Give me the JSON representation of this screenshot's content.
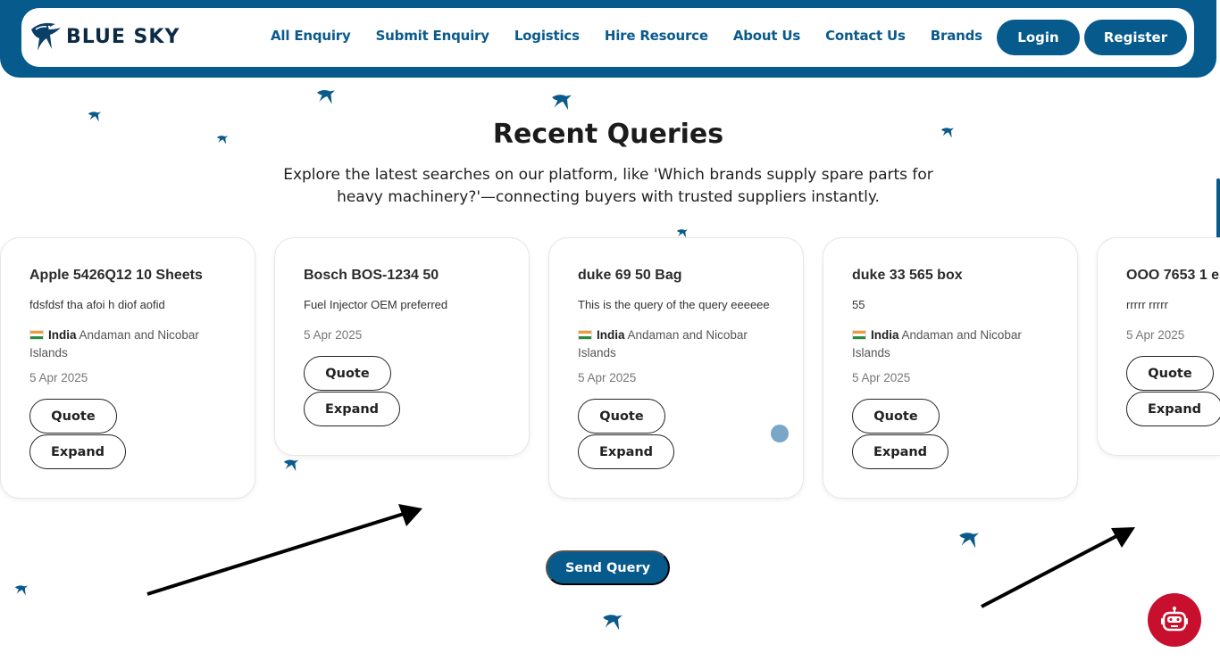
{
  "header": {
    "logo_text": "BLUE SKY",
    "nav": [
      "All Enquiry",
      "Submit Enquiry",
      "Logistics",
      "Hire Resource",
      "About Us",
      "Contact Us",
      "Brands"
    ],
    "login_label": "Login",
    "register_label": "Register"
  },
  "hero": {
    "title": "Recent Queries",
    "subtitle": "Explore the latest searches on our platform, like 'Which brands supply spare parts for heavy machinery?'—connecting buyers with trusted suppliers instantly."
  },
  "cards": [
    {
      "title": "Apple 5426Q12 10 Sheets",
      "desc": "fdsfdsf tha afoi h diof aofid",
      "country": "India",
      "region": "Andaman and Nicobar Islands",
      "date": "5 Apr 2025",
      "quote": "Quote",
      "expand": "Expand"
    },
    {
      "title": "Bosch BOS-1234 50",
      "desc": "Fuel Injector OEM preferred",
      "country": "",
      "region": "",
      "date": "5 Apr 2025",
      "quote": "Quote",
      "expand": "Expand"
    },
    {
      "title": "duke 69 50 Bag",
      "desc": "This is the query of the query eeeeee",
      "country": "India",
      "region": "Andaman and Nicobar Islands",
      "date": "5 Apr 2025",
      "quote": "Quote",
      "expand": "Expand"
    },
    {
      "title": "duke 33 565 box",
      "desc": "55",
      "country": "India",
      "region": "Andaman and Nicobar Islands",
      "date": "5 Apr 2025",
      "quote": "Quote",
      "expand": "Expand"
    },
    {
      "title": "OOO 7653 1 e",
      "desc": "rrrrr rrrrr",
      "country": "",
      "region": "",
      "date": "5 Apr 2025",
      "quote": "Quote",
      "expand": "Expand"
    }
  ],
  "send_query_label": "Send Query",
  "colors": {
    "brand": "#075a8c",
    "chatbot": "#c8102e"
  },
  "icons": [
    "eagle-logo-icon",
    "flag-india-icon",
    "bird-icon",
    "chatbot-icon"
  ]
}
